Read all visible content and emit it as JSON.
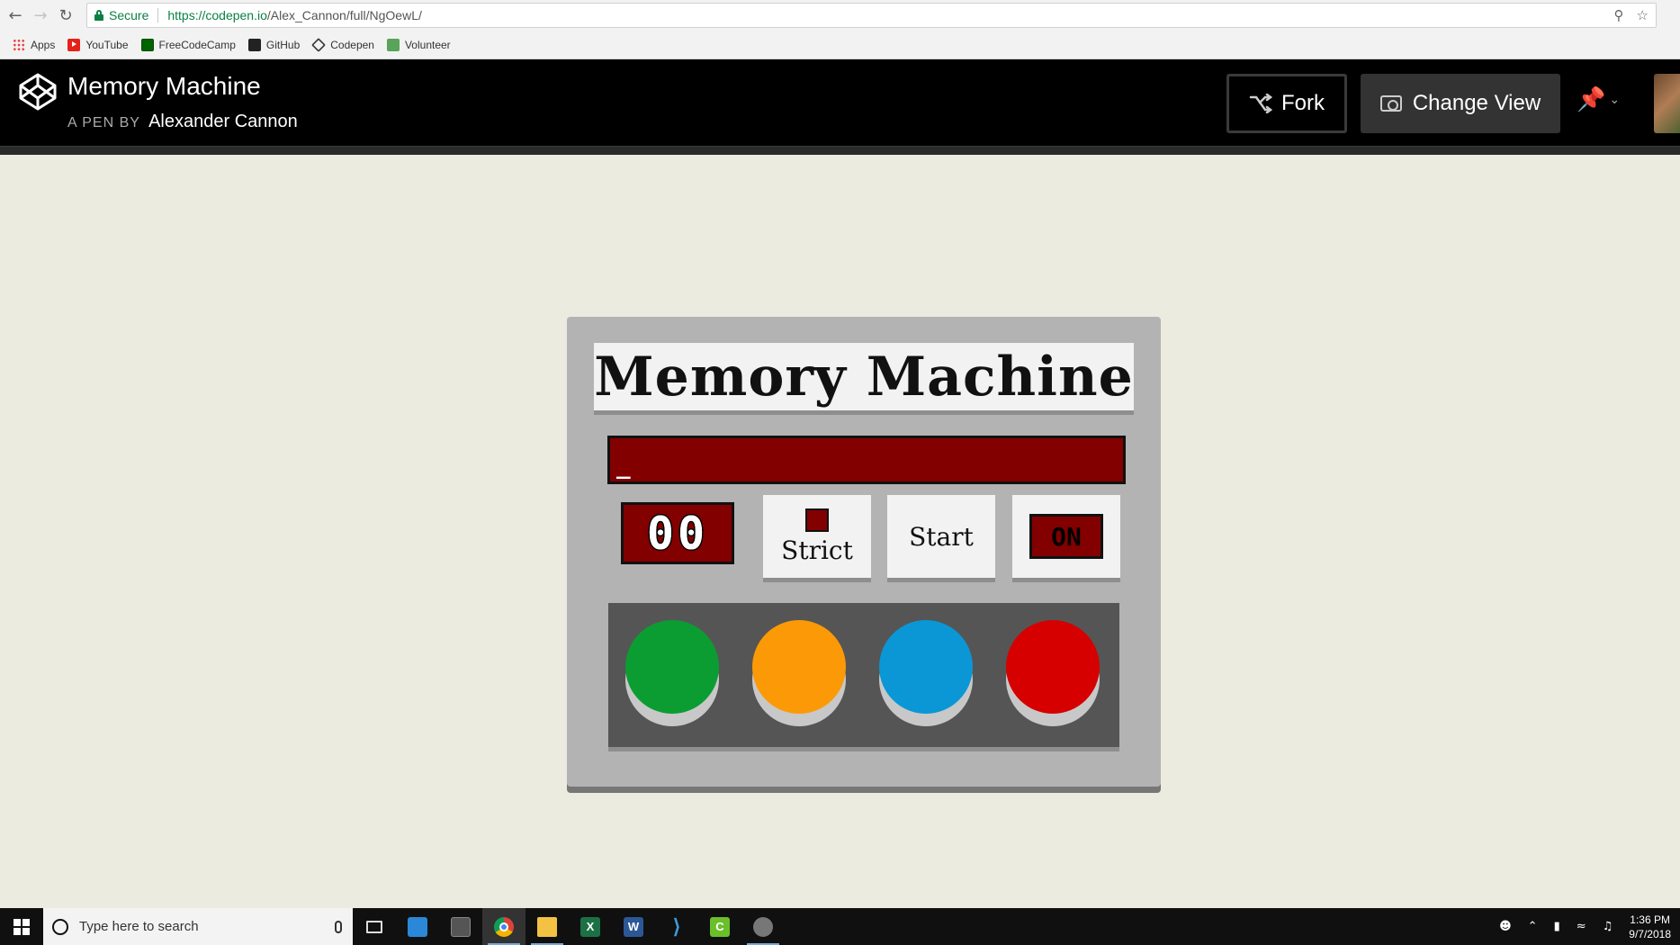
{
  "browser": {
    "secure_label": "Secure",
    "url_host": "https://codepen.io",
    "url_path": "/Alex_Cannon/full/NgOewL/",
    "bookmarks": [
      {
        "label": "Apps",
        "icon": "apps-grid-icon"
      },
      {
        "label": "YouTube",
        "icon": "youtube-icon"
      },
      {
        "label": "FreeCodeCamp",
        "icon": "freecodecamp-icon"
      },
      {
        "label": "GitHub",
        "icon": "github-icon"
      },
      {
        "label": "Codepen",
        "icon": "codepen-icon"
      },
      {
        "label": "Volunteer",
        "icon": "volunteer-icon"
      }
    ]
  },
  "header": {
    "title": "Memory Machine",
    "byline_prefix": "A PEN BY",
    "author": "Alexander Cannon",
    "fork_label": "Fork",
    "change_view_label": "Change View"
  },
  "machine": {
    "title": "Memory Machine",
    "display_text": "_",
    "counter": "00",
    "strict_label": "Strict",
    "start_label": "Start",
    "power_label": "ON",
    "colors": {
      "panel": "#b3b3b3",
      "led": "#820000",
      "green": "#0b9d32",
      "orange": "#fb9a06",
      "blue": "#0b97d6",
      "red": "#d60000"
    }
  },
  "taskbar": {
    "search_placeholder": "Type here to search",
    "time": "1:36 PM",
    "date": "9/7/2018",
    "apps": [
      "task-view",
      "store",
      "calculator",
      "chrome",
      "file-explorer",
      "excel",
      "word",
      "vscode",
      "camtasia",
      "gimp"
    ]
  }
}
